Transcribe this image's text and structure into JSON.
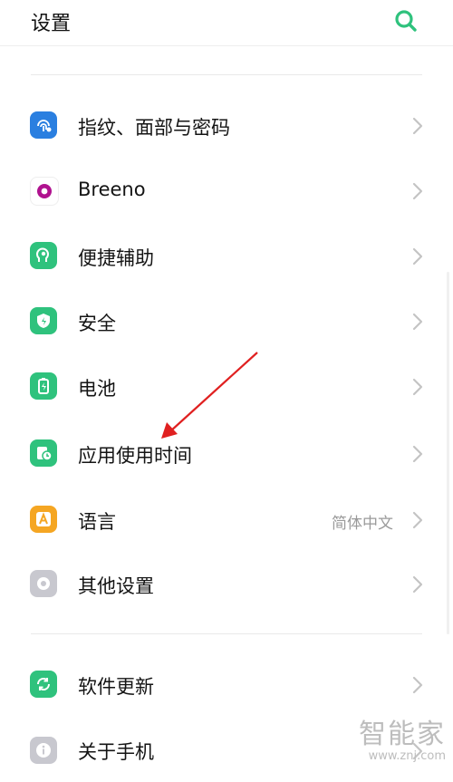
{
  "header": {
    "title": "设置",
    "search_icon": "search-icon"
  },
  "colors": {
    "accent": "#2fc27d",
    "blue": "#2a7fe0",
    "purple": "#b0128f",
    "orange": "#f5a623",
    "gray": "#c8c8cf",
    "annotation_red": "#e02020"
  },
  "items": [
    {
      "label": "指纹、面部与密码",
      "icon": "fingerprint-icon"
    },
    {
      "label": "Breeno",
      "icon": "breeno-icon"
    },
    {
      "label": "便捷辅助",
      "icon": "accessibility-icon"
    },
    {
      "label": "安全",
      "icon": "shield-icon"
    },
    {
      "label": "电池",
      "icon": "battery-icon"
    },
    {
      "label": "应用使用时间",
      "icon": "app-usage-time-icon"
    },
    {
      "label": "语言",
      "icon": "language-icon",
      "value": "简体中文"
    },
    {
      "label": "其他设置",
      "icon": "other-settings-icon"
    },
    {
      "label": "软件更新",
      "icon": "software-update-icon"
    },
    {
      "label": "关于手机",
      "icon": "about-phone-icon"
    }
  ],
  "watermark": {
    "main": "智能家",
    "sub": "www.znj.com"
  }
}
